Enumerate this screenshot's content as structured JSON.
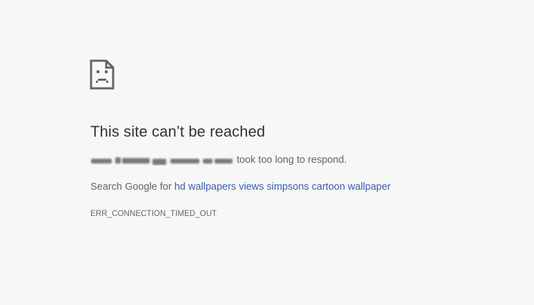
{
  "error": {
    "icon": "sad-page-icon",
    "title": "This site can’t be reached",
    "response_text": "took too long to respond.",
    "search_prefix": "Search Google for",
    "search_query": "hd wallpapers views simpsons cartoon wallpaper",
    "code": "ERR_CONNECTION_TIMED_OUT"
  },
  "colors": {
    "background": "#f7f7f7",
    "title": "#333333",
    "body_text": "#646464",
    "link": "#3a5ea8"
  }
}
